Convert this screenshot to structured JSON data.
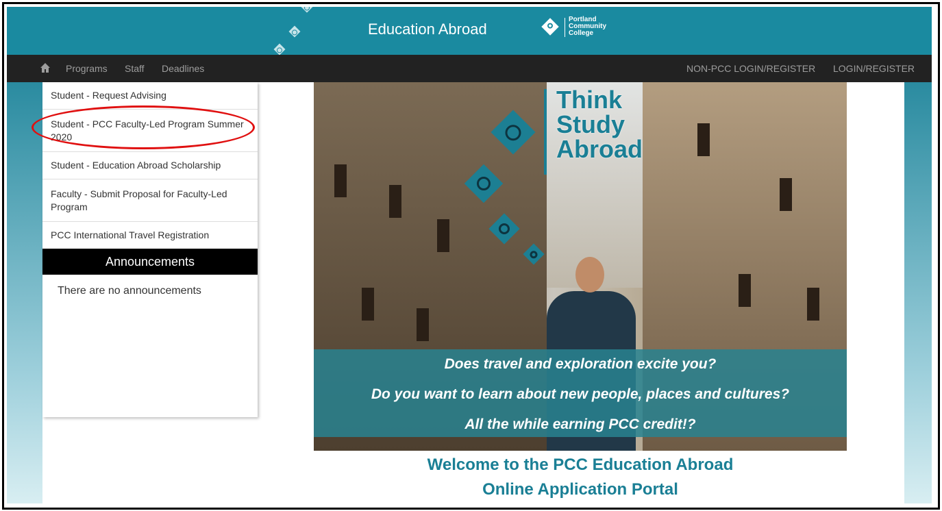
{
  "header": {
    "title": "Education Abroad",
    "college": [
      "Portland",
      "Community",
      "College"
    ]
  },
  "nav": {
    "home_icon": "home-icon",
    "links": [
      "Programs",
      "Staff",
      "Deadlines"
    ],
    "right_links": [
      "NON-PCC LOGIN/REGISTER",
      "LOGIN/REGISTER"
    ]
  },
  "sidebar": {
    "items": [
      {
        "label": "Student - Request Advising"
      },
      {
        "label": "Student - PCC Faculty-Led Program Summer 2020"
      },
      {
        "label": "Student - Education Abroad Scholarship"
      },
      {
        "label": "Faculty - Submit Proposal for Faculty-Led Program"
      },
      {
        "label": "PCC International Travel Registration"
      }
    ],
    "announcements_title": "Announcements",
    "announcements_empty": "There are no announcements"
  },
  "hero": {
    "think": [
      "Think",
      "Study",
      "Abroad"
    ],
    "lines": [
      "Does travel and exploration excite you?",
      "Do you want to learn about new people, places and cultures?",
      "All the while earning PCC credit!?"
    ]
  },
  "welcome": [
    "Welcome to the PCC Education Abroad",
    "Online Application Portal"
  ],
  "colors": {
    "teal": "#1a8aa0",
    "nav_bg": "#222222",
    "highlight": "#e01010"
  }
}
